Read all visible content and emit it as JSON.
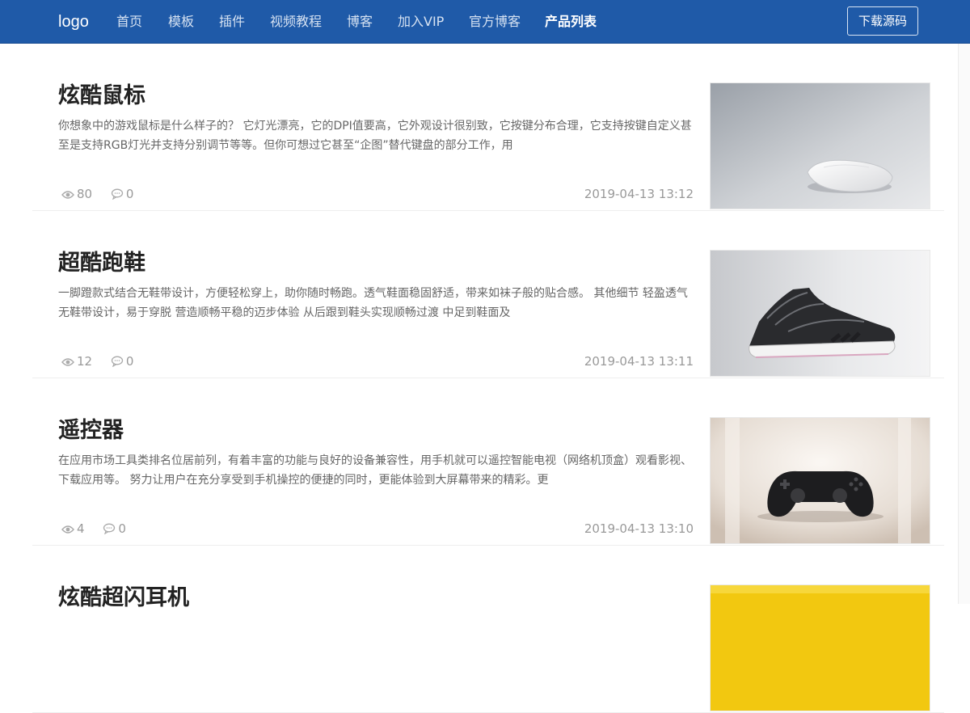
{
  "nav": {
    "logo": "logo",
    "items": [
      {
        "label": "首页"
      },
      {
        "label": "模板"
      },
      {
        "label": "插件"
      },
      {
        "label": "视频教程"
      },
      {
        "label": "博客"
      },
      {
        "label": "加入VIP"
      },
      {
        "label": "官方博客"
      },
      {
        "label": "产品列表",
        "active": true
      }
    ],
    "download_label": "下载源码"
  },
  "articles": [
    {
      "title": "炫酷鼠标",
      "summary": "你想象中的游戏鼠标是什么样子的？ 它灯光漂亮，它的DPI值要高，它外观设计很别致，它按键分布合理，它支持按键自定义甚至是支持RGB灯光并支持分别调节等等。但你可想过它甚至“企图”替代键盘的部分工作，用",
      "views": "80",
      "comments": "0",
      "date": "2019-04-13 13:12",
      "thumb": "mouse"
    },
    {
      "title": "超酷跑鞋",
      "summary": "一脚蹬款式结合无鞋带设计，方便轻松穿上，助你随时畅跑。透气鞋面稳固舒适，带来如袜子般的贴合感。 其他细节 轻盈透气 无鞋带设计，易于穿脱 营造顺畅平稳的迈步体验 从后跟到鞋头实现顺畅过渡 中足到鞋面及",
      "views": "12",
      "comments": "0",
      "date": "2019-04-13 13:11",
      "thumb": "sneaker"
    },
    {
      "title": "遥控器",
      "summary": "在应用市场工具类排名位居前列，有着丰富的功能与良好的设备兼容性，用手机就可以遥控智能电视（网络机顶盒）观看影视、下载应用等。 努力让用户在充分享受到手机操控的便捷的同时，更能体验到大屏幕带来的精彩。更",
      "views": "4",
      "comments": "0",
      "date": "2019-04-13 13:10",
      "thumb": "gamepad"
    },
    {
      "title": "炫酷超闪耳机",
      "summary": "",
      "views": "",
      "comments": "",
      "date": "",
      "thumb": "yellow"
    }
  ]
}
